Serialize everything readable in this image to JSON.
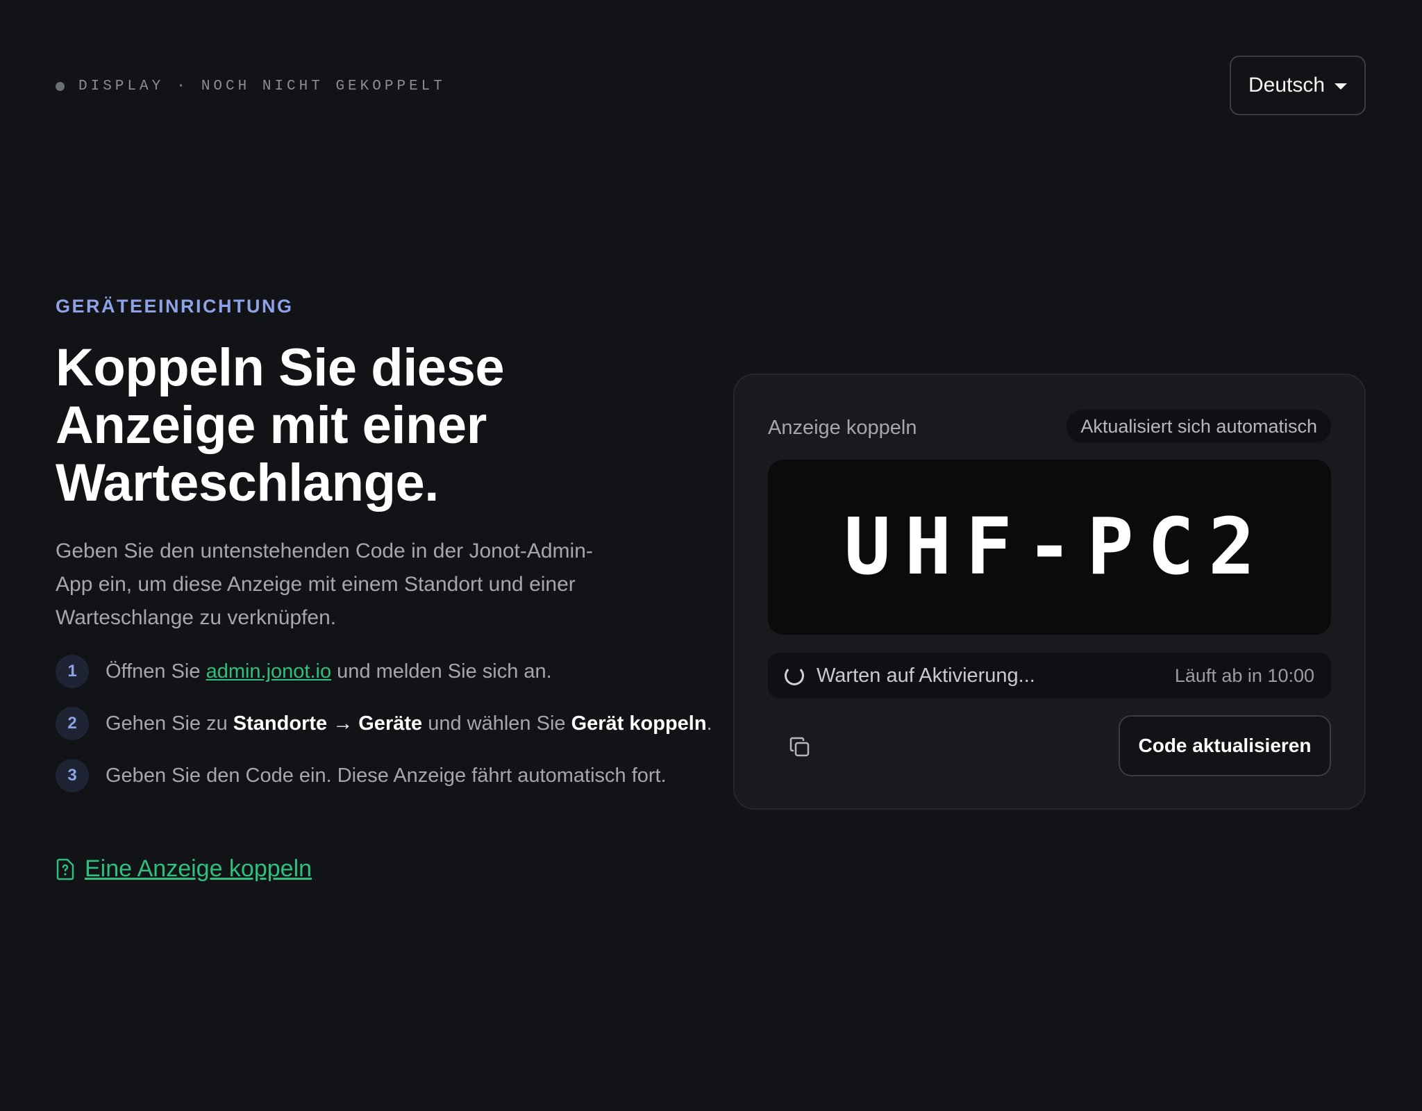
{
  "header": {
    "status_label": "DISPLAY",
    "status_separator": "·",
    "status_value": "NOCH NICHT GEKOPPELT",
    "language": "Deutsch"
  },
  "intro": {
    "eyebrow": "GERÄTEEINRICHTUNG",
    "heading": "Koppeln Sie diese Anzeige mit einer Warteschlange.",
    "description": "Geben Sie den untenstehenden Code in der Jonot-Admin-App ein, um diese Anzeige mit einem Standort und einer Warteschlange zu verknüpfen."
  },
  "steps": [
    {
      "number": "1",
      "prefix": "Öffnen Sie ",
      "link": "admin.jonot.io",
      "suffix": " und melden Sie sich an."
    },
    {
      "number": "2",
      "prefix": "Gehen Sie zu ",
      "bold1": "Standorte → Geräte",
      "middle": " und wählen Sie ",
      "bold2": "Gerät koppeln",
      "suffix": "."
    },
    {
      "number": "3",
      "text": "Geben Sie den Code ein. Diese Anzeige fährt automatisch fort."
    }
  ],
  "help_link": {
    "label": "Eine Anzeige koppeln",
    "icon": "help-document-icon"
  },
  "card": {
    "title": "Anzeige koppeln",
    "badge": "Aktualisiert sich automatisch",
    "code": "UHF-PC2",
    "waiting_text": "Warten auf Aktivierung...",
    "expiry": "Läuft ab in 10:00",
    "copy_icon": "copy-icon",
    "refresh_label": "Code aktualisieren"
  },
  "colors": {
    "background": "#111316",
    "card": "#181a1e",
    "accent_blue": "#8ea2e8",
    "accent_green": "#2fbf7f"
  }
}
